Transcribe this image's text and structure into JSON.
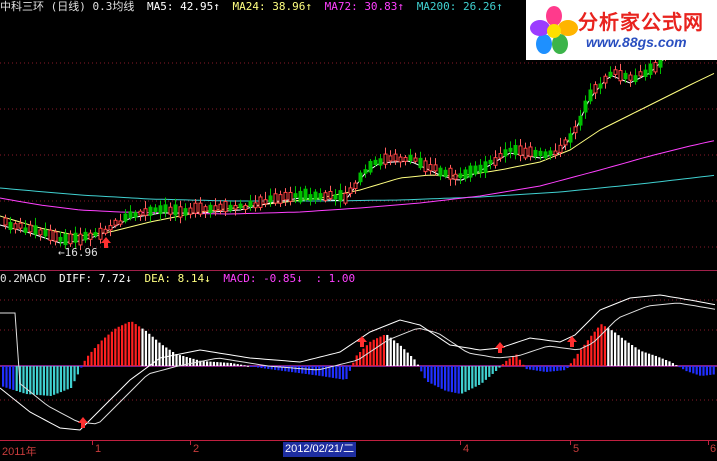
{
  "price_header": {
    "title": "中科三环 (日线) 0.3均线",
    "ma5": "MA5: 42.95↑",
    "ma24": "MA24: 38.96↑",
    "ma72": "MA72: 30.83↑",
    "ma200": "MA200: 26.26↑"
  },
  "macd_header": {
    "title": "0.2MACD",
    "diff": "DIFF: 7.72↓",
    "dea": "DEA: 8.14↓",
    "macd": "MACD: -0.85↓",
    "extra": ": 1.00"
  },
  "low_label": "←16.96",
  "time_axis": {
    "ticks": [
      "2011年",
      "1",
      "2",
      "4",
      "5",
      "6"
    ],
    "cursor_date": "2012/02/21/二"
  },
  "watermark": {
    "title": "分析家公式网",
    "url": "www.88gs.com"
  },
  "colors": {
    "ma5": "#ffffff",
    "ma24": "#ffff80",
    "ma72": "#ff40ff",
    "ma200": "#40d0d0",
    "up_candle": "#ff4040",
    "down_candle": "#00c000",
    "macd_pos": "#ff2020",
    "macd_neg": "#2030ff",
    "grid": "#8a1a2a"
  },
  "icons": [
    "buy-arrow-icon",
    "flower-logo-icon"
  ]
}
